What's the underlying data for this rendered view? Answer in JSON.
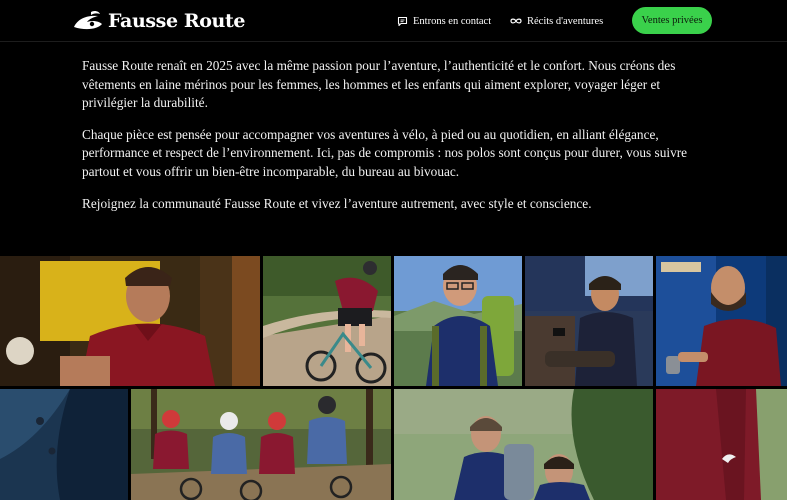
{
  "brand": {
    "name": "Fausse Route",
    "logo_icon": "wave-swirl-logo-icon"
  },
  "nav": {
    "contact_label": "Entrons en contact",
    "contact_icon": "chat-bubble-icon",
    "stories_label": "Récits d'aventures",
    "stories_icon": "infinity-icon"
  },
  "cta": {
    "label": "Ventes privées",
    "color": "#3ad14b"
  },
  "intro": {
    "paragraphs": [
      "Fausse Route renaît en 2025 avec la même passion pour l’aventure, l’authenticité et le confort. Nous créons des vêtements en laine mérinos pour les femmes, les hommes et les enfants qui aiment explorer, voyager léger et privilégier la durabilité.",
      "Chaque pièce est pensée pour accompagner vos aventures à vélo, à pied ou au quotidien, en alliant élégance, performance et respect de l’environnement. Ici, pas de compromis : nos polos sont conçus pour durer, vous suivre partout et vous offrir un bien-être incomparable, du bureau au bivouac.",
      "Rejoignez la communauté Fausse Route et vivez l’aventure autrement, avec style et conscience."
    ]
  },
  "gallery": {
    "photos": [
      "man-in-burgundy-polo-photo",
      "cyclist-on-gravel-trail-photo",
      "smiling-hiker-with-backpack-photo",
      "man-on-train-with-phone-photo",
      "bearded-man-with-mug-photo",
      "navy-polo-detail-photo",
      "group-of-cyclists-photo",
      "hikers-on-mountain-photo",
      "burgundy-polo-closeup-photo"
    ]
  }
}
